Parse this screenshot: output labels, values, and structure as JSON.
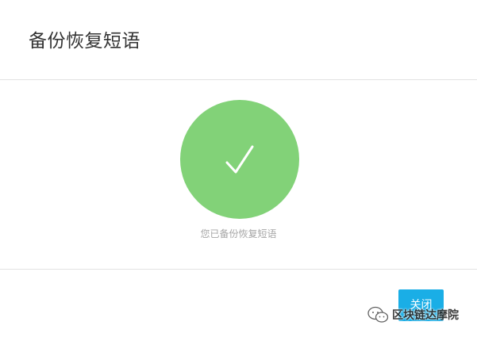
{
  "dialog": {
    "title": "备份恢复短语"
  },
  "status": {
    "icon": "checkmark-icon",
    "message": "您已备份恢复短语",
    "color": "#82d278"
  },
  "footer": {
    "close_label": "关闭",
    "button_color": "#1aaee6"
  },
  "watermark": {
    "icon": "wechat-icon",
    "text": "区块链达摩院"
  }
}
